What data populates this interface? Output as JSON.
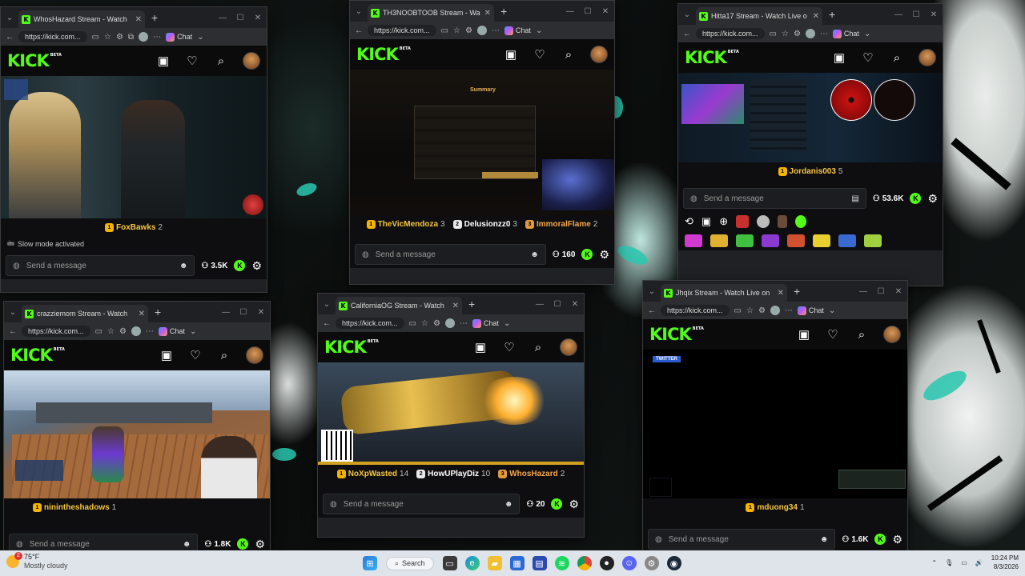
{
  "desktop": {
    "wallpaper": "anime-ink-splatter"
  },
  "windows": [
    {
      "tab_title": "WhosHazard Stream - Watch",
      "url": "https://kick.com...",
      "chat_button": "Chat",
      "names": [
        {
          "name": "FoxBawks",
          "points": "2",
          "badge": "1"
        }
      ],
      "slow_mode": "Slow mode activated",
      "message_placeholder": "Send a message",
      "viewers": "3.5K"
    },
    {
      "tab_title": "TH3NOOBTOOB Stream - Wa",
      "url": "https://kick.com...",
      "chat_button": "Chat",
      "video_overlay_title": "Summary",
      "names": [
        {
          "name": "TheVicMendoza",
          "points": "3",
          "badge": "1"
        },
        {
          "name": "Delusionzz0",
          "points": "3",
          "badge": "2"
        },
        {
          "name": "ImmoralFlame",
          "points": "2",
          "badge": "3"
        }
      ],
      "message_placeholder": "Send a message",
      "viewers": "160"
    },
    {
      "tab_title": "Hitta17 Stream - Watch Live o",
      "url": "https://kick.com...",
      "chat_button": "Chat",
      "names": [
        {
          "name": "Jordanis003",
          "points": "5",
          "badge": "1"
        }
      ],
      "message_placeholder": "Send a message",
      "viewers": "53.6K"
    },
    {
      "tab_title": "crazziemom Stream - Watch",
      "url": "https://kick.com...",
      "chat_button": "Chat",
      "names": [
        {
          "name": "ninintheshadows",
          "points": "1",
          "badge": "1"
        }
      ],
      "message_placeholder": "Send a message",
      "viewers": "1.8K"
    },
    {
      "tab_title": "CaliforniaOG Stream - Watch",
      "url": "https://kick.com...",
      "chat_button": "Chat",
      "names": [
        {
          "name": "NoXpWasted",
          "points": "14",
          "badge": "1"
        },
        {
          "name": "HowUPlayDiz",
          "points": "10",
          "badge": "2"
        },
        {
          "name": "WhosHazard",
          "points": "2",
          "badge": "3"
        }
      ],
      "message_placeholder": "Send a message",
      "viewers": "20"
    },
    {
      "tab_title": "Jhqix Stream - Watch Live on",
      "url": "https://kick.com...",
      "chat_button": "Chat",
      "overlay_label": "TWITTER",
      "names": [
        {
          "name": "mduong34",
          "points": "1",
          "badge": "1"
        }
      ],
      "message_placeholder": "Send a message",
      "viewers": "1.6K"
    }
  ],
  "brand": {
    "logo": "KICK",
    "logo_sup": "BETA",
    "accent": "#53fc18"
  },
  "taskbar": {
    "weather_temp": "75°F",
    "weather_desc": "Mostly cloudy",
    "weather_badge": "2",
    "search_label": "Search",
    "time": "10:24 PM",
    "date": "8/3/2026"
  }
}
